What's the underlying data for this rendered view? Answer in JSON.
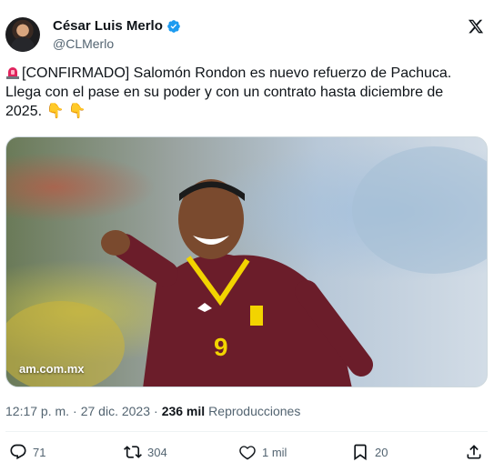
{
  "author": {
    "name": "César Luis Merlo",
    "handle": "@CLMerlo"
  },
  "tweet": {
    "line1": "[CONFIRMADO] Salomón Rondon es nuevo refuerzo de Pachuca.",
    "line2": "Llega con el pase en su poder y con un contrato hasta diciembre de",
    "line3": "2025.",
    "emojis": "👇 👇"
  },
  "media": {
    "watermark": "am.com.mx",
    "jersey_number": "9"
  },
  "meta": {
    "time": "12:17 p. m.",
    "sep": "·",
    "date": "27 dic. 2023",
    "views_count": "236 mil",
    "views_label": "Reproducciones"
  },
  "actions": {
    "replies": "71",
    "reposts": "304",
    "likes": "1 mil",
    "bookmarks": "20"
  },
  "colors": {
    "verified": "#1d9bf0",
    "text_primary": "#0f1419",
    "text_secondary": "#536471",
    "jersey": "#6b1d2a",
    "jersey_trim": "#f2d400"
  },
  "icons": [
    "verified-icon",
    "x-logo-icon",
    "siren-icon",
    "reply-icon",
    "repost-icon",
    "like-icon",
    "bookmark-icon",
    "share-icon"
  ]
}
